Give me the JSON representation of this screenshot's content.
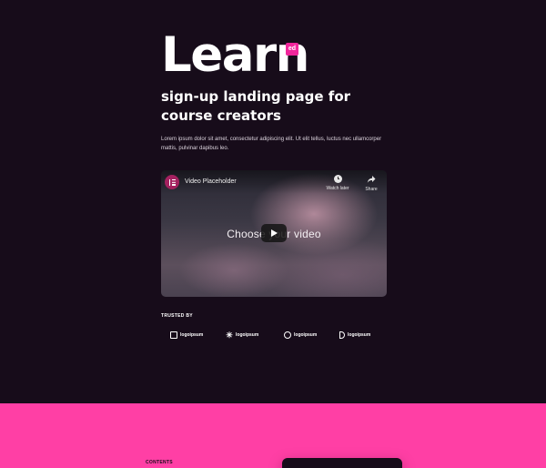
{
  "brand": {
    "word": "Learn",
    "badge": "ed"
  },
  "hero": {
    "headline": "sign-up landing page for course creators",
    "lede": "Lorem ipsum dolor sit amet, consectetur adipiscing elit. Ut elit tellus, luctus nec ullamcorper mattis, pulvinar dapibus leo."
  },
  "video": {
    "title": "Video Placeholder",
    "caption": "Choose your video",
    "watch_later": "Watch later",
    "share": "Share"
  },
  "trusted": {
    "heading": "TRUSTED BY",
    "logos": [
      "logoipsum",
      "logoipsum",
      "logoipsum",
      "logoipsum"
    ]
  },
  "contents": {
    "label": "CONTENTS"
  },
  "colors": {
    "background": "#170c1a",
    "accent": "#ff3fa5",
    "badge": "#f0269b"
  }
}
